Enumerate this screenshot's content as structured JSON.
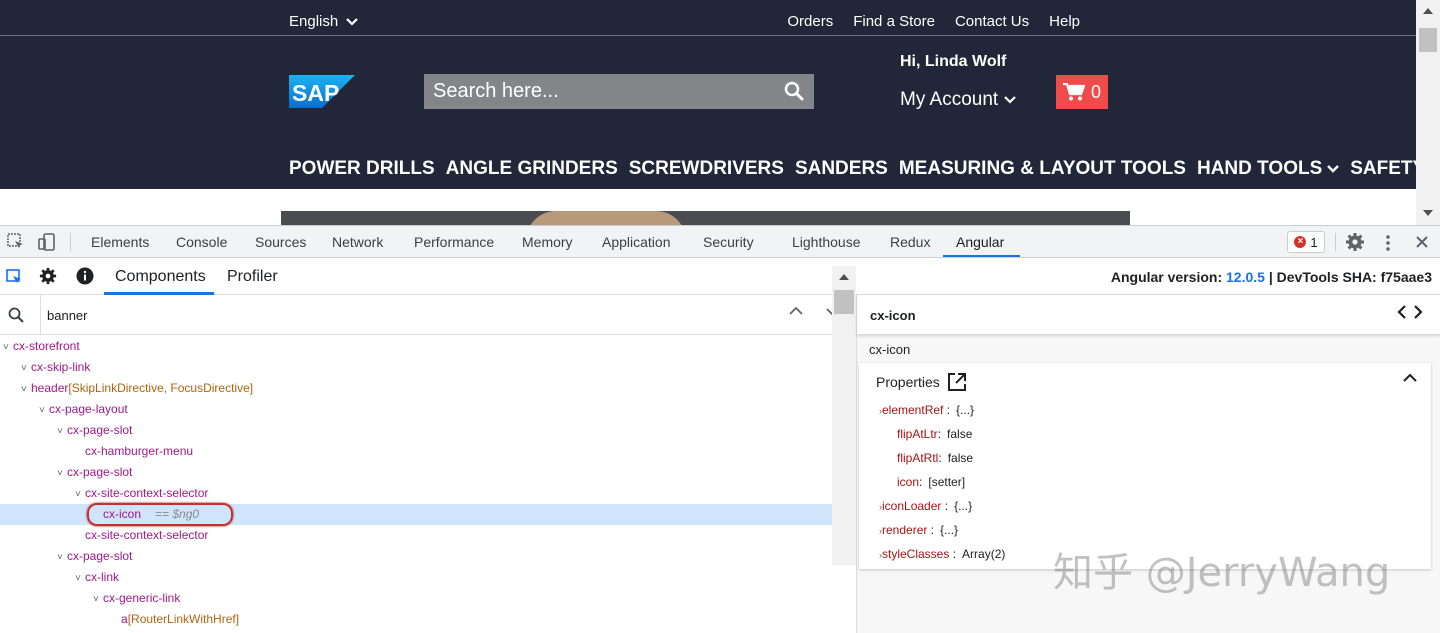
{
  "storefront": {
    "language": "English",
    "top_links": [
      "Orders",
      "Find a Store",
      "Contact Us",
      "Help"
    ],
    "logo_text": "SAP",
    "search_placeholder": "Search here...",
    "greeting": "Hi, Linda Wolf",
    "my_account": "My Account",
    "cart_count": "0",
    "nav": [
      {
        "label": "POWER DRILLS",
        "dropdown": false
      },
      {
        "label": "ANGLE GRINDERS",
        "dropdown": false
      },
      {
        "label": "SCREWDRIVERS",
        "dropdown": false
      },
      {
        "label": "SANDERS",
        "dropdown": false
      },
      {
        "label": "MEASURING & LAYOUT TOOLS",
        "dropdown": false
      },
      {
        "label": "HAND TOOLS",
        "dropdown": true
      },
      {
        "label": "SAFETY",
        "dropdown": true
      }
    ],
    "colors": {
      "header_bg": "#212738",
      "cart_bg": "#ef4b4b",
      "search_bg": "#838589"
    }
  },
  "devtools": {
    "tabs": [
      "Elements",
      "Console",
      "Sources",
      "Network",
      "Performance",
      "Memory",
      "Application",
      "Security",
      "Lighthouse",
      "Redux",
      "Angular"
    ],
    "active_tab": "Angular",
    "error_count": "1",
    "angular": {
      "tabs": [
        "Components",
        "Profiler"
      ],
      "active_tab": "Components",
      "version_label": "Angular version: ",
      "version": "12.0.5",
      "sha_label": " | DevTools SHA: f75aae3"
    },
    "filter_value": "banner",
    "tree": [
      {
        "name": "cx-storefront",
        "directives": "",
        "depth": 0,
        "caret": true
      },
      {
        "name": "cx-skip-link",
        "directives": "",
        "depth": 1,
        "caret": true
      },
      {
        "name": "header",
        "directives": "[SkipLinkDirective, FocusDirective]",
        "depth": 1,
        "caret": true
      },
      {
        "name": "cx-page-layout",
        "directives": "",
        "depth": 2,
        "caret": true
      },
      {
        "name": "cx-page-slot",
        "directives": "",
        "depth": 3,
        "caret": true
      },
      {
        "name": "cx-hamburger-menu",
        "directives": "",
        "depth": 4,
        "caret": false
      },
      {
        "name": "cx-page-slot",
        "directives": "",
        "depth": 3,
        "caret": true
      },
      {
        "name": "cx-site-context-selector",
        "directives": "",
        "depth": 4,
        "caret": true
      },
      {
        "name": "cx-icon",
        "directives": "",
        "depth": 5,
        "caret": false,
        "selected": true,
        "ref": "== $ng0"
      },
      {
        "name": "cx-site-context-selector",
        "directives": "",
        "depth": 4,
        "caret": false
      },
      {
        "name": "cx-page-slot",
        "directives": "",
        "depth": 3,
        "caret": true
      },
      {
        "name": "cx-link",
        "directives": "",
        "depth": 4,
        "caret": true
      },
      {
        "name": "cx-generic-link",
        "directives": "",
        "depth": 5,
        "caret": true
      },
      {
        "name": "a",
        "directives": "[RouterLinkWithHref]",
        "depth": 6,
        "caret": false
      }
    ],
    "details": {
      "title": "cx-icon",
      "subtitle": "cx-icon",
      "properties_label": "Properties",
      "properties": [
        {
          "key": "elementRef",
          "value": "{...}",
          "expandable": true,
          "indent": 0
        },
        {
          "key": "flipAtLtr",
          "value": "false",
          "expandable": false,
          "indent": 1
        },
        {
          "key": "flipAtRtl",
          "value": "false",
          "expandable": false,
          "indent": 1
        },
        {
          "key": "icon",
          "value": "[setter]",
          "expandable": false,
          "indent": 1
        },
        {
          "key": "iconLoader",
          "value": "{...}",
          "expandable": true,
          "indent": 0
        },
        {
          "key": "renderer",
          "value": "{...}",
          "expandable": true,
          "indent": 0
        },
        {
          "key": "styleClasses",
          "value": "Array(2)",
          "expandable": true,
          "indent": 0
        }
      ]
    }
  },
  "watermark": "知乎 @JerryWang"
}
